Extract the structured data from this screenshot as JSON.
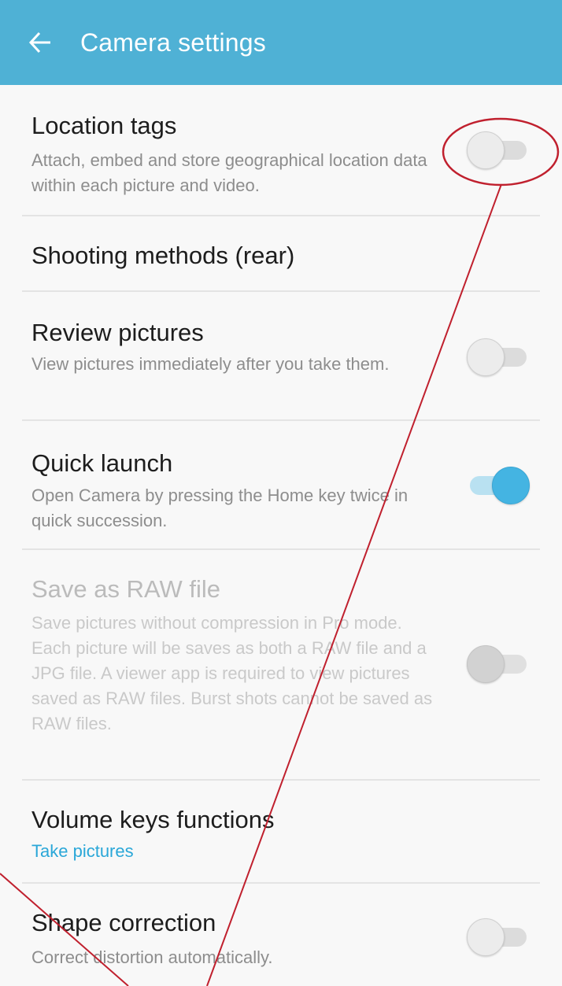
{
  "appbar": {
    "title": "Camera settings",
    "back_icon": "arrow-left-icon"
  },
  "settings": [
    {
      "title": "Location tags",
      "subtitle": "Attach, embed and store geographical location data within each picture and video.",
      "toggle": "off",
      "enabled": true
    },
    {
      "title": "Shooting methods (rear)",
      "enabled": true
    },
    {
      "title": "Review pictures",
      "subtitle": "View pictures immediately after you take them.",
      "toggle": "off",
      "enabled": true
    },
    {
      "title": "Quick launch",
      "subtitle": "Open Camera by pressing the Home key twice in quick succession.",
      "toggle": "on",
      "enabled": true
    },
    {
      "title": "Save as RAW file",
      "subtitle": "Save pictures without compression in Pro mode. Each picture will be saves as both a RAW file and a JPG file. A viewer app is required to view pictures saved as RAW files. Burst shots cannot be saved as RAW files.",
      "toggle": "off",
      "enabled": false
    },
    {
      "title": "Volume keys functions",
      "value": "Take pictures",
      "enabled": true
    },
    {
      "title": "Shape correction",
      "subtitle": "Correct distortion automatically.",
      "toggle": "off",
      "enabled": true
    }
  ],
  "colors": {
    "appbar": "#4fb1d5",
    "accent": "#44b4e2",
    "link": "#2aa7d8",
    "annotation": "#c0202e"
  }
}
